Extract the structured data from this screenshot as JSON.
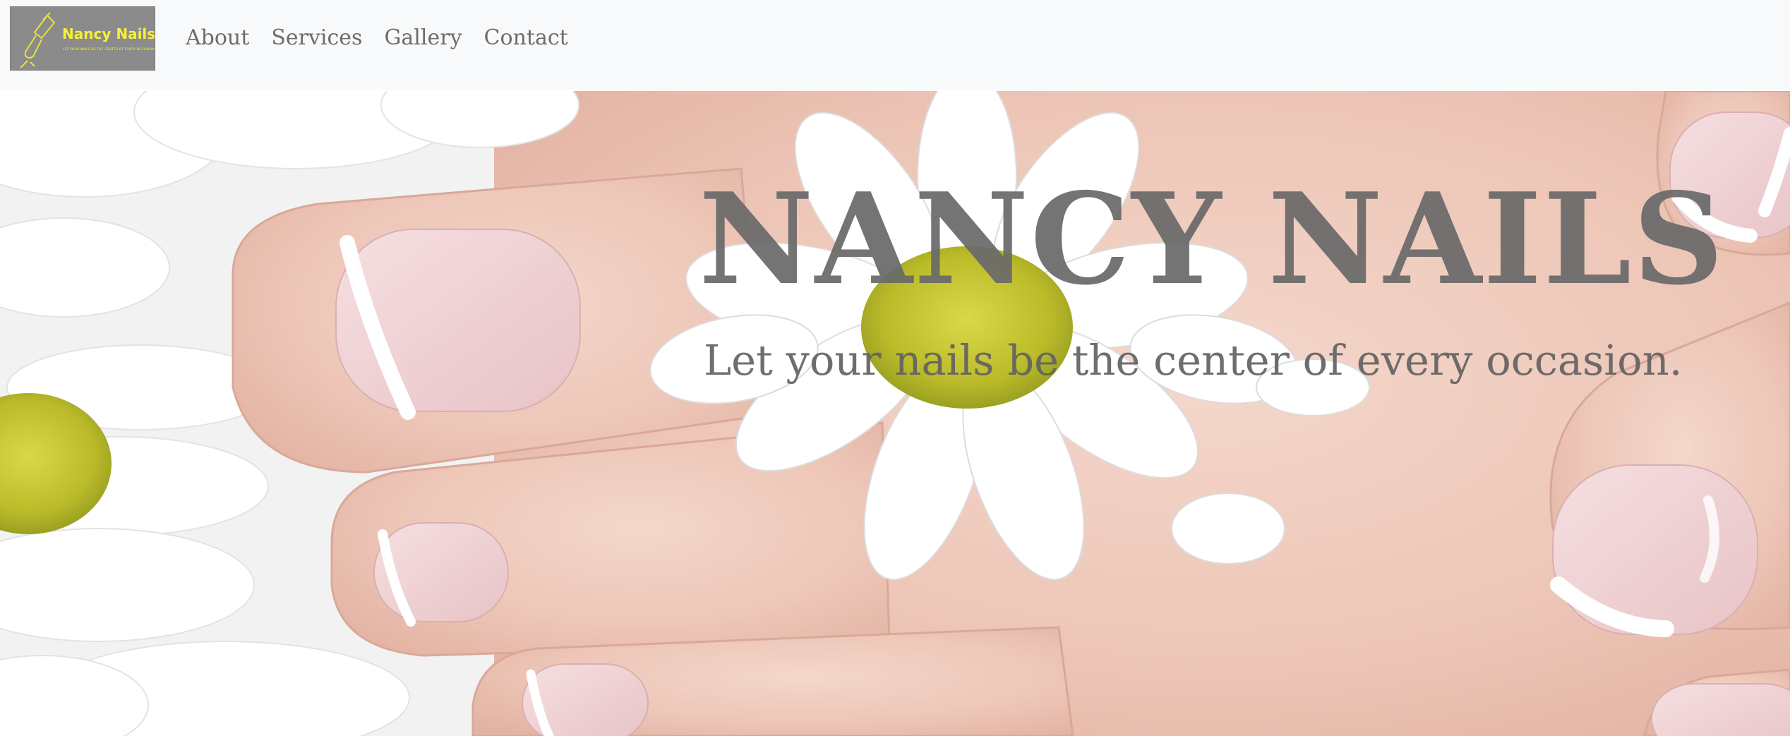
{
  "brand": {
    "name": "Nancy Nails",
    "tagline": "LET YOUR NAILS BE THE CENTER OF EVERY OCCASION"
  },
  "nav": {
    "items": [
      {
        "label": "About"
      },
      {
        "label": "Services"
      },
      {
        "label": "Gallery"
      },
      {
        "label": "Contact"
      }
    ]
  },
  "hero": {
    "title": "NANCY NAILS",
    "subtitle": "Let your nails be the center of every occasion."
  },
  "colors": {
    "navbar_bg": "#f8f9fa",
    "nav_text": "#6c6c6c",
    "logo_bg": "#8b8b8b",
    "logo_accent": "#f6f03a",
    "hero_text": "#6a6a6a"
  }
}
